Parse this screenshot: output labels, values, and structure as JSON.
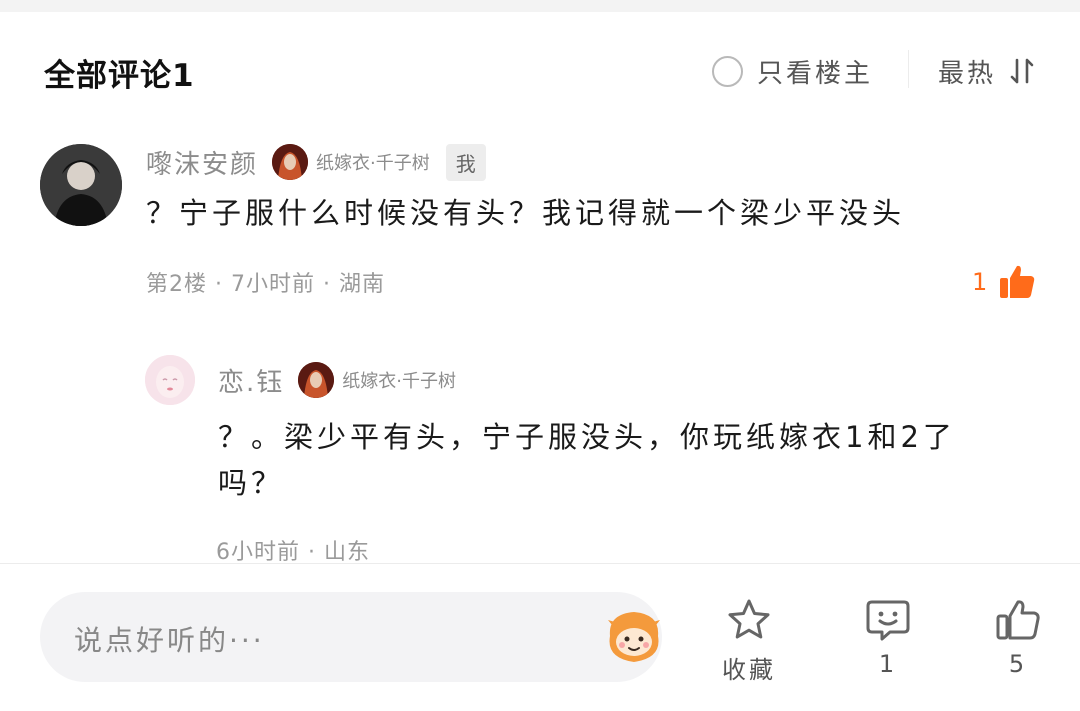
{
  "header": {
    "title": "全部评论1",
    "only_op_label": "只看楼主",
    "sort_label": "最热"
  },
  "comment": {
    "username": "嚟沫安颜",
    "fan_badge": "纸嫁衣·千子树",
    "me_tag": "我",
    "text": "？宁子服什么时候没有头？我记得就一个梁少平没头",
    "meta": "第2楼 · 7小时前 · 湖南",
    "likes": "1"
  },
  "reply": {
    "username": "恋.钰",
    "fan_badge": "纸嫁衣·千子树",
    "text_line1": "？。梁少平有头，宁子服没头，你玩纸嫁衣1和2了",
    "text_line2": "吗？",
    "meta": "6小时前 · 山东"
  },
  "bottom_bar": {
    "input_placeholder": "说点好听的···",
    "collect_label": "收藏",
    "comment_count": "1",
    "like_count": "5"
  },
  "colors": {
    "accent": "#ff6b1a",
    "icon_gray": "#666666"
  }
}
